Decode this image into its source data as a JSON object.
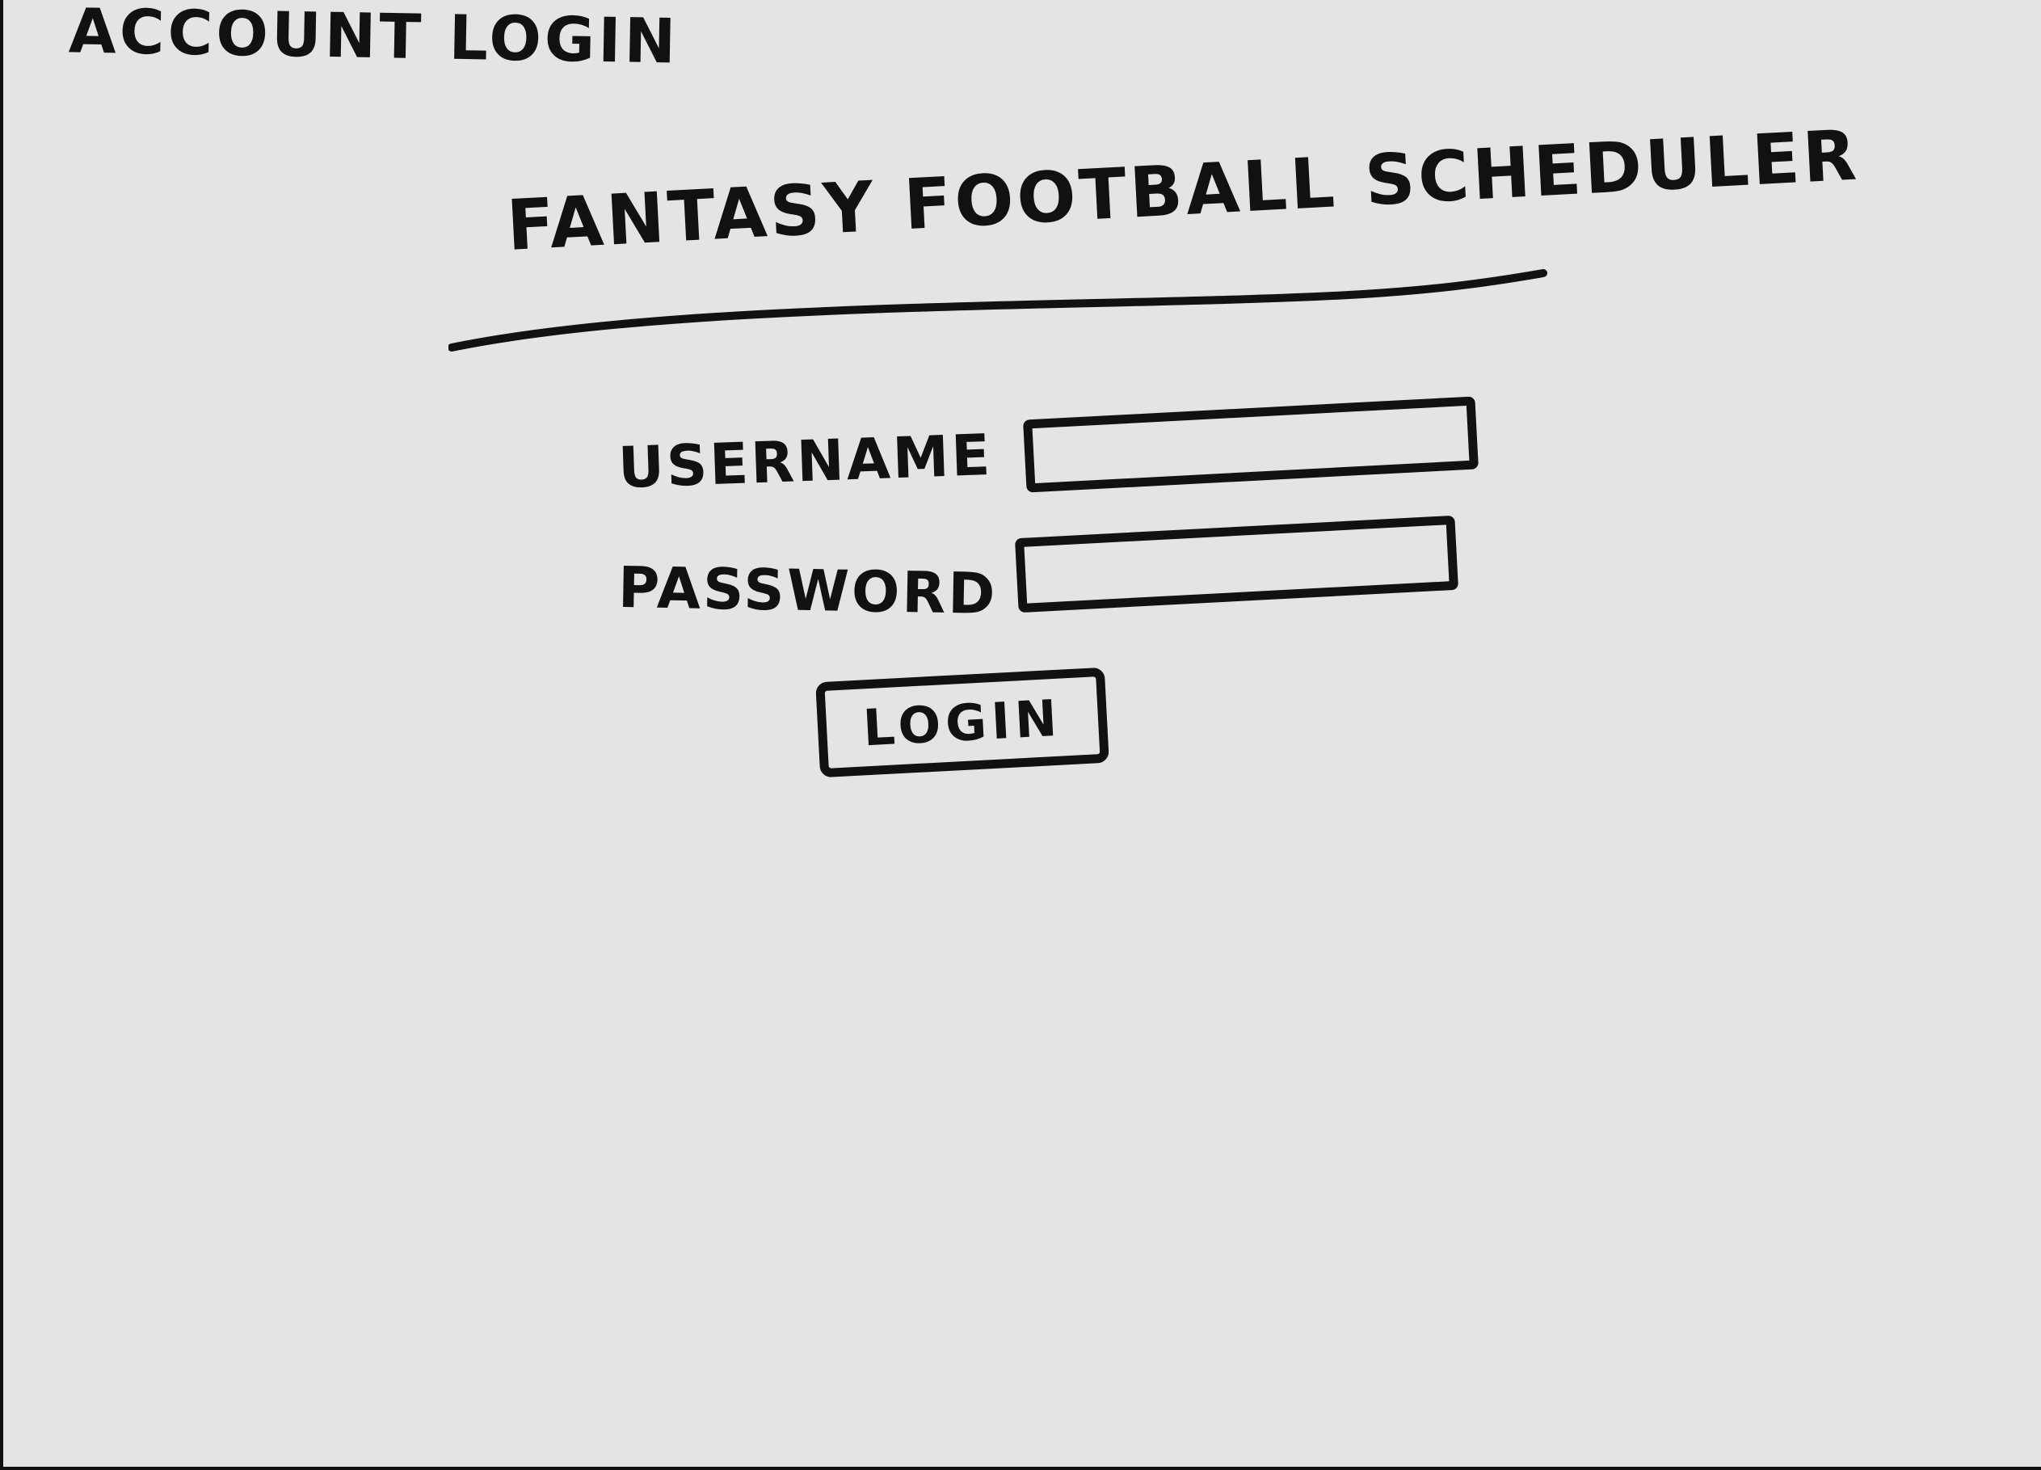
{
  "page": {
    "label": "ACCOUNT LOGIN"
  },
  "app": {
    "title": "FANTASY FOOTBALL SCHEDULER"
  },
  "form": {
    "username_label": "USERNAME",
    "username_value": "",
    "password_label": "PASSWORD",
    "password_value": "",
    "login_label": "LOGIN"
  },
  "colors": {
    "background": "#e4e4e4",
    "ink": "#111111"
  }
}
